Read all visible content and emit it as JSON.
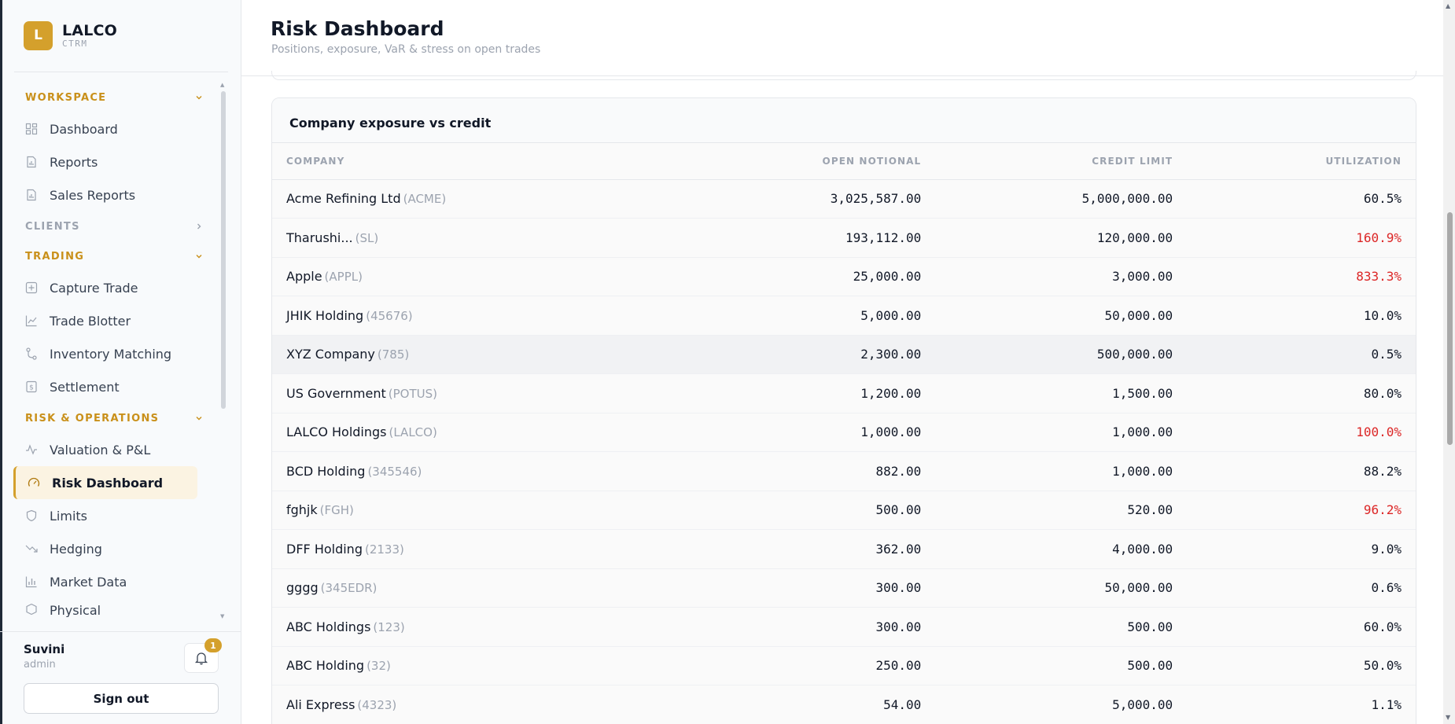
{
  "brand": {
    "initial": "L",
    "name": "LALCO",
    "sub": "CTRM"
  },
  "nav": {
    "sections": [
      {
        "label": "WORKSPACE",
        "expanded": true,
        "items": [
          "Dashboard",
          "Reports",
          "Sales Reports"
        ]
      },
      {
        "label": "CLIENTS",
        "expanded": false,
        "items": []
      },
      {
        "label": "TRADING",
        "expanded": true,
        "items": [
          "Capture Trade",
          "Trade Blotter",
          "Inventory Matching",
          "Settlement"
        ]
      },
      {
        "label": "RISK & OPERATIONS",
        "expanded": true,
        "items": [
          "Valuation & P&L",
          "Risk Dashboard",
          "Limits",
          "Hedging",
          "Market Data",
          "Physical"
        ]
      }
    ],
    "active_item": "Risk Dashboard"
  },
  "user": {
    "name": "Suvini",
    "role": "admin",
    "notifications": "1",
    "sign_out": "Sign out"
  },
  "header": {
    "title": "Risk Dashboard",
    "subtitle": "Positions, exposure, VaR & stress on open trades"
  },
  "exposure": {
    "title": "Company exposure vs credit",
    "columns": [
      "COMPANY",
      "OPEN NOTIONAL",
      "CREDIT LIMIT",
      "UTILIZATION"
    ],
    "rows": [
      {
        "name": "Acme Refining Ltd",
        "code": "(ACME)",
        "notional": "3,025,587.00",
        "limit": "5,000,000.00",
        "util": "60.5%"
      },
      {
        "name": "Tharushi...",
        "code": "(SL)",
        "notional": "193,112.00",
        "limit": "120,000.00",
        "util": "160.9%"
      },
      {
        "name": "Apple",
        "code": "(APPL)",
        "notional": "25,000.00",
        "limit": "3,000.00",
        "util": "833.3%"
      },
      {
        "name": "JHIK Holding",
        "code": "(45676)",
        "notional": "5,000.00",
        "limit": "50,000.00",
        "util": "10.0%"
      },
      {
        "name": "XYZ Company",
        "code": "(785)",
        "notional": "2,300.00",
        "limit": "500,000.00",
        "util": "0.5%"
      },
      {
        "name": "US Government",
        "code": "(POTUS)",
        "notional": "1,200.00",
        "limit": "1,500.00",
        "util": "80.0%"
      },
      {
        "name": "LALCO Holdings",
        "code": "(LALCO)",
        "notional": "1,000.00",
        "limit": "1,000.00",
        "util": "100.0%"
      },
      {
        "name": "BCD Holding",
        "code": "(345546)",
        "notional": "882.00",
        "limit": "1,000.00",
        "util": "88.2%"
      },
      {
        "name": "fghjk",
        "code": "(FGH)",
        "notional": "500.00",
        "limit": "520.00",
        "util": "96.2%"
      },
      {
        "name": "DFF Holding",
        "code": "(2133)",
        "notional": "362.00",
        "limit": "4,000.00",
        "util": "9.0%"
      },
      {
        "name": "gggg",
        "code": "(345EDR)",
        "notional": "300.00",
        "limit": "50,000.00",
        "util": "0.6%"
      },
      {
        "name": "ABC Holdings",
        "code": "(123)",
        "notional": "300.00",
        "limit": "500.00",
        "util": "60.0%"
      },
      {
        "name": "ABC Holding",
        "code": "(32)",
        "notional": "250.00",
        "limit": "500.00",
        "util": "50.0%"
      },
      {
        "name": "Ali Express",
        "code": "(4323)",
        "notional": "54.00",
        "limit": "5,000.00",
        "util": "1.1%"
      }
    ],
    "warning_color": "#dc2626"
  },
  "colors": {
    "accent": "#d4a02c",
    "active_bg": "#fbf3e2"
  }
}
